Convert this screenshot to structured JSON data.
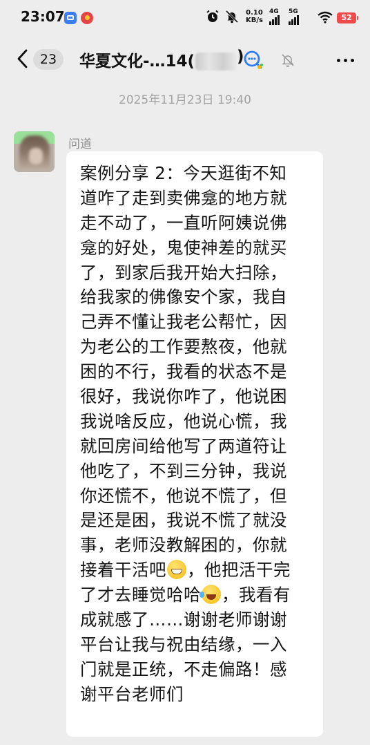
{
  "status_bar": {
    "time": "23:07",
    "app_icons": [
      "notes-app-icon",
      "weibo-app-icon"
    ],
    "speed_value": "0.10",
    "speed_unit": "KB/s",
    "sim1_label": "4G",
    "sim2_label": "5G",
    "battery_level": "52"
  },
  "header": {
    "back_icon": "chevron-left-icon",
    "unread_count": "23",
    "title": "华夏文化-…14(",
    "title_close": ")",
    "search_icon": "search-chat-icon",
    "mute_icon": "bell-off-icon",
    "more_icon": "more-dots-icon"
  },
  "chat": {
    "timestamp": "2025年11月23日 19:40",
    "message": {
      "sender": "问道",
      "lines": [
        "案例分享 2：今天逛街不知",
        "道咋了走到卖佛龛的地方就",
        "走不动了，一直听阿姨说佛",
        "龛的好处，鬼使神差的就买",
        "了，到家后我开始大扫除，",
        "给我家的佛像安个家，我自",
        "己弄不懂让我老公帮忙，因",
        "为老公的工作要熬夜，他就",
        "困的不行，我看的状态不是",
        "很好，我说你咋了，他说困",
        "我说啥反应，他说心慌，我",
        "就回房间给他写了两道符让",
        "他吃了，不到三分钟，我说",
        "你还慌不，他说不慌了，但",
        "是还是困，我说不慌了就没",
        "事，老师没教解困的，你就"
      ],
      "line17_a": "接着干活吧",
      "line17_b": "，他把活干完",
      "line18_a": "了才去睡觉哈哈",
      "line18_b": "，我看有",
      "lines_tail": [
        "成就感了……谢谢老师谢谢",
        "平台让我与祝由结缘，一入",
        "门就是正统，不走偏路！感",
        "谢平台老师们"
      ],
      "emojis": [
        "grinning-emoji",
        "tears-of-joy-emoji"
      ]
    }
  },
  "colors": {
    "background": "#ededed",
    "bubble": "#ffffff",
    "timestamp_text": "#a3a3a3",
    "battery": "#ef4b4b"
  }
}
